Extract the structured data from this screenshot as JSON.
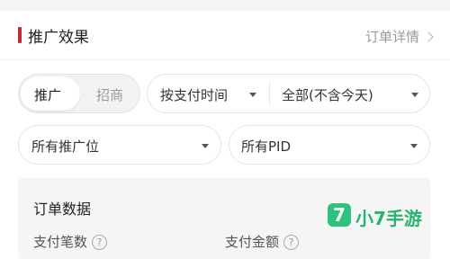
{
  "header": {
    "title": "推广效果",
    "detail_link": "订单详情"
  },
  "segmented": {
    "options": [
      "推广",
      "招商"
    ],
    "selected": "推广"
  },
  "filters": {
    "time_type": "按支付时间",
    "time_range": "全部(不含今天)",
    "position": "所有推广位",
    "pid": "所有PID"
  },
  "order_data": {
    "title": "订单数据",
    "metrics": [
      {
        "label": "支付笔数",
        "help": "?"
      },
      {
        "label": "支付金额",
        "help": "?"
      }
    ]
  },
  "watermark": {
    "logo_char": "7",
    "text": "小7手游"
  },
  "colors": {
    "accent": "#c8273a",
    "watermark_green": "#2ec27e"
  }
}
